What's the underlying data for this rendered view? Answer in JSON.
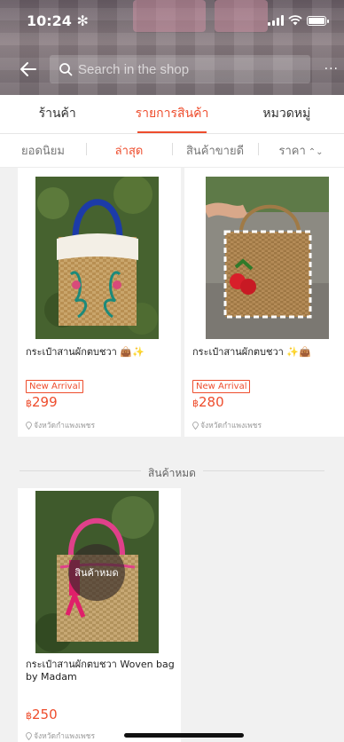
{
  "status": {
    "time": "10:24 ✻"
  },
  "search": {
    "placeholder": "Search in the shop"
  },
  "more_label": "···",
  "tabs": [
    {
      "label": "ร้านค้า",
      "active": false
    },
    {
      "label": "รายการสินค้า",
      "active": true
    },
    {
      "label": "หมวดหมู่",
      "active": false
    }
  ],
  "sorts": [
    {
      "label": "ยอดนิยม",
      "active": false
    },
    {
      "label": "ล่าสุด",
      "active": true
    },
    {
      "label": "สินค้าขายดี",
      "active": false
    },
    {
      "label": "ราคา",
      "active": false,
      "arrows": "⌃⌄"
    }
  ],
  "products": [
    {
      "name": "กระเป๋าสานผักตบชวา 👜✨",
      "badge": "New Arrival",
      "currency": "฿",
      "price": "299",
      "location": "จังหวัดกำแพงเพชร"
    },
    {
      "name": "กระเป๋าสานผักตบชวา ✨👜",
      "badge": "New Arrival",
      "currency": "฿",
      "price": "280",
      "location": "จังหวัดกำแพงเพชร"
    }
  ],
  "soldout_section": {
    "title": "สินค้าหมด",
    "overlay": "สินค้าหมด",
    "product": {
      "name": "กระเป๋าสานผักตบชวา Woven bag by Madam",
      "currency": "฿",
      "price": "250",
      "location": "จังหวัดกำแพงเพชร"
    }
  },
  "colors": {
    "accent": "#ee4d2d"
  }
}
